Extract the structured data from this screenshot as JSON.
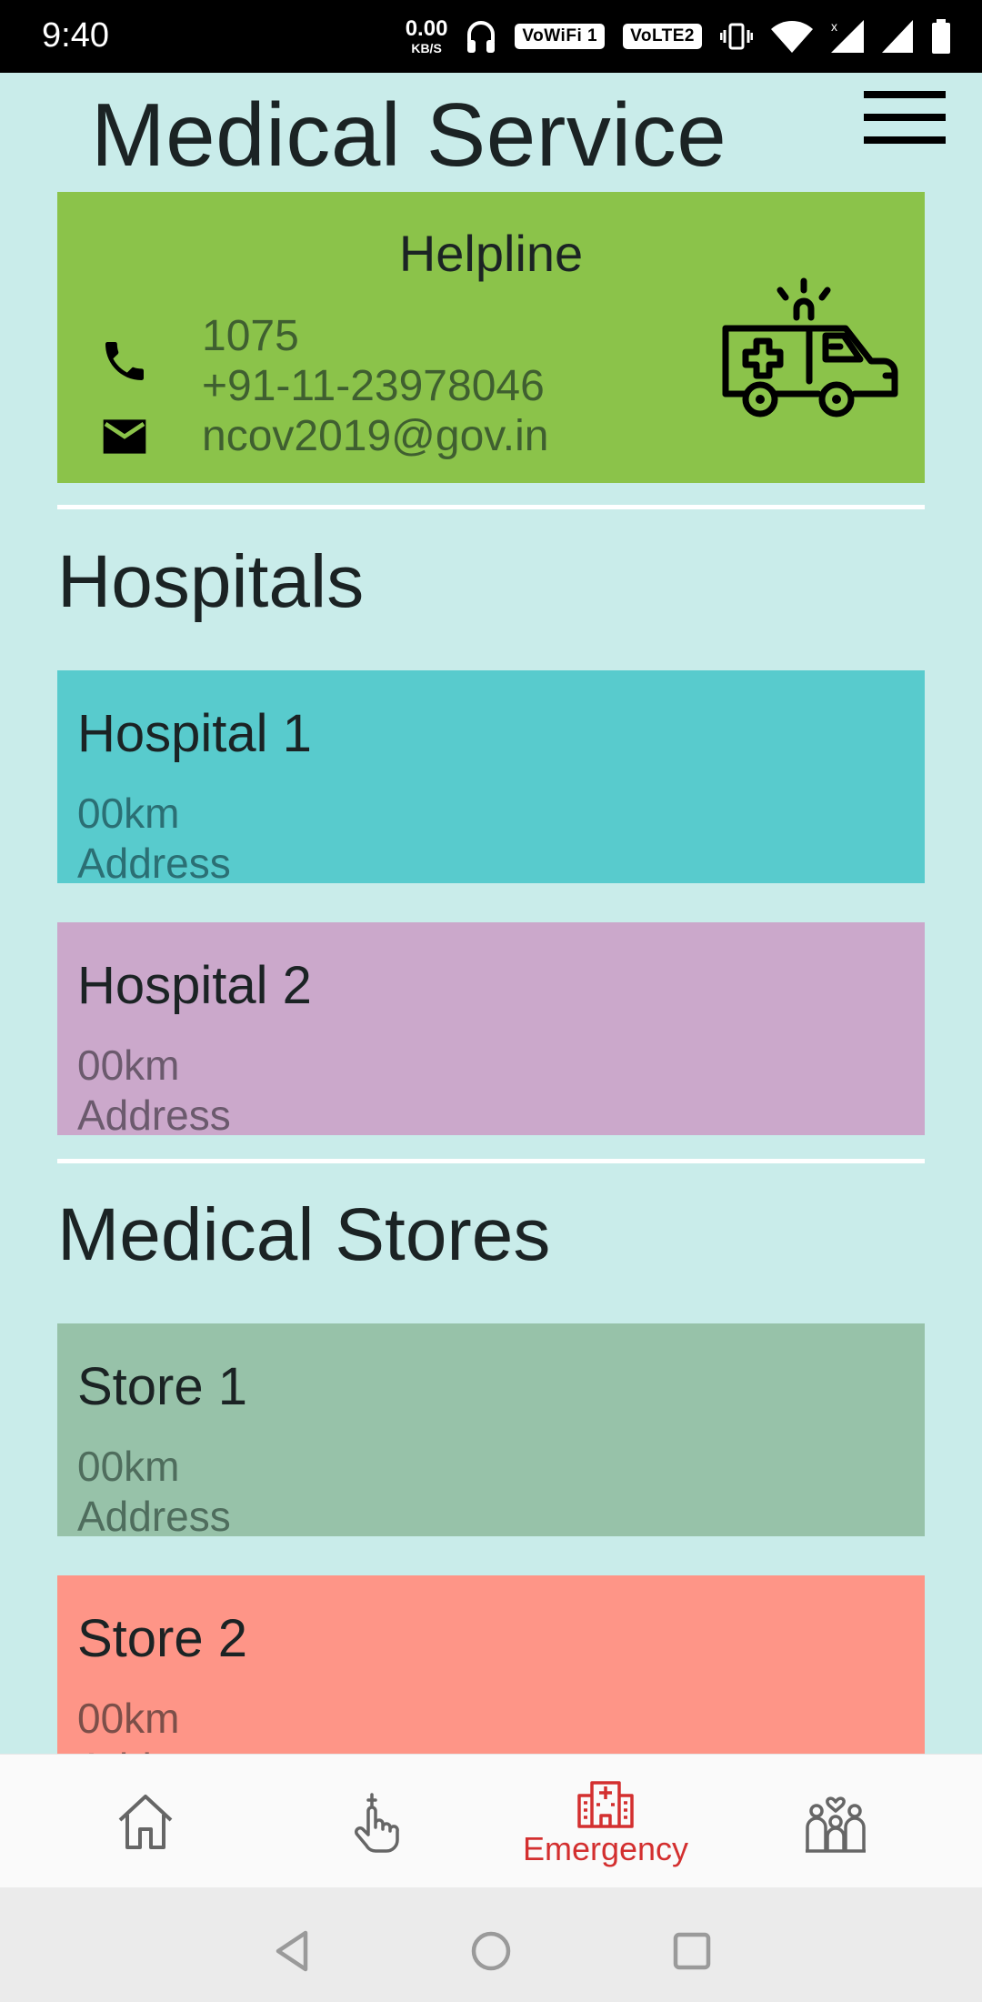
{
  "status_bar": {
    "time": "9:40",
    "net_speed_value": "0.00",
    "net_speed_unit": "KB/S",
    "wifi_badge": "VoWiFi 1",
    "lte_badge": "VoLTE2",
    "icons": [
      "headphones-icon",
      "vibrate-icon",
      "wifi-icon",
      "signal-icon",
      "signal-icon",
      "battery-icon"
    ]
  },
  "header": {
    "title": "Medical Service",
    "menu_icon": "hamburger-menu-icon"
  },
  "helpline": {
    "title": "Helpline",
    "phone_1": "1075",
    "phone_2": "+91-11-23978046",
    "email": "ncov2019@gov.in",
    "bg_color": "#8bc34a"
  },
  "hospitals": {
    "title": "Hospitals",
    "items": [
      {
        "name": "Hospital 1",
        "distance": "00km",
        "address": "Address",
        "color": "#58cbcd"
      },
      {
        "name": "Hospital 2",
        "distance": "00km",
        "address": "Address",
        "color": "#cba8cb"
      }
    ]
  },
  "stores": {
    "title": "Medical Stores",
    "items": [
      {
        "name": "Store 1",
        "distance": "00km",
        "address": "Address",
        "color": "#97c2a9"
      },
      {
        "name": "Store 2",
        "distance": "00km",
        "address": "Address",
        "color": "#fe9587"
      }
    ]
  },
  "bottom_nav": {
    "items": [
      {
        "icon": "home-icon",
        "label": ""
      },
      {
        "icon": "hand-pointer-icon",
        "label": ""
      },
      {
        "icon": "hospital-icon",
        "label": "Emergency",
        "active": true
      },
      {
        "icon": "family-icon",
        "label": ""
      }
    ],
    "active_color": "#d32f2f"
  },
  "system_nav": {
    "icons": [
      "back-icon",
      "home-circle-icon",
      "recents-icon"
    ]
  }
}
